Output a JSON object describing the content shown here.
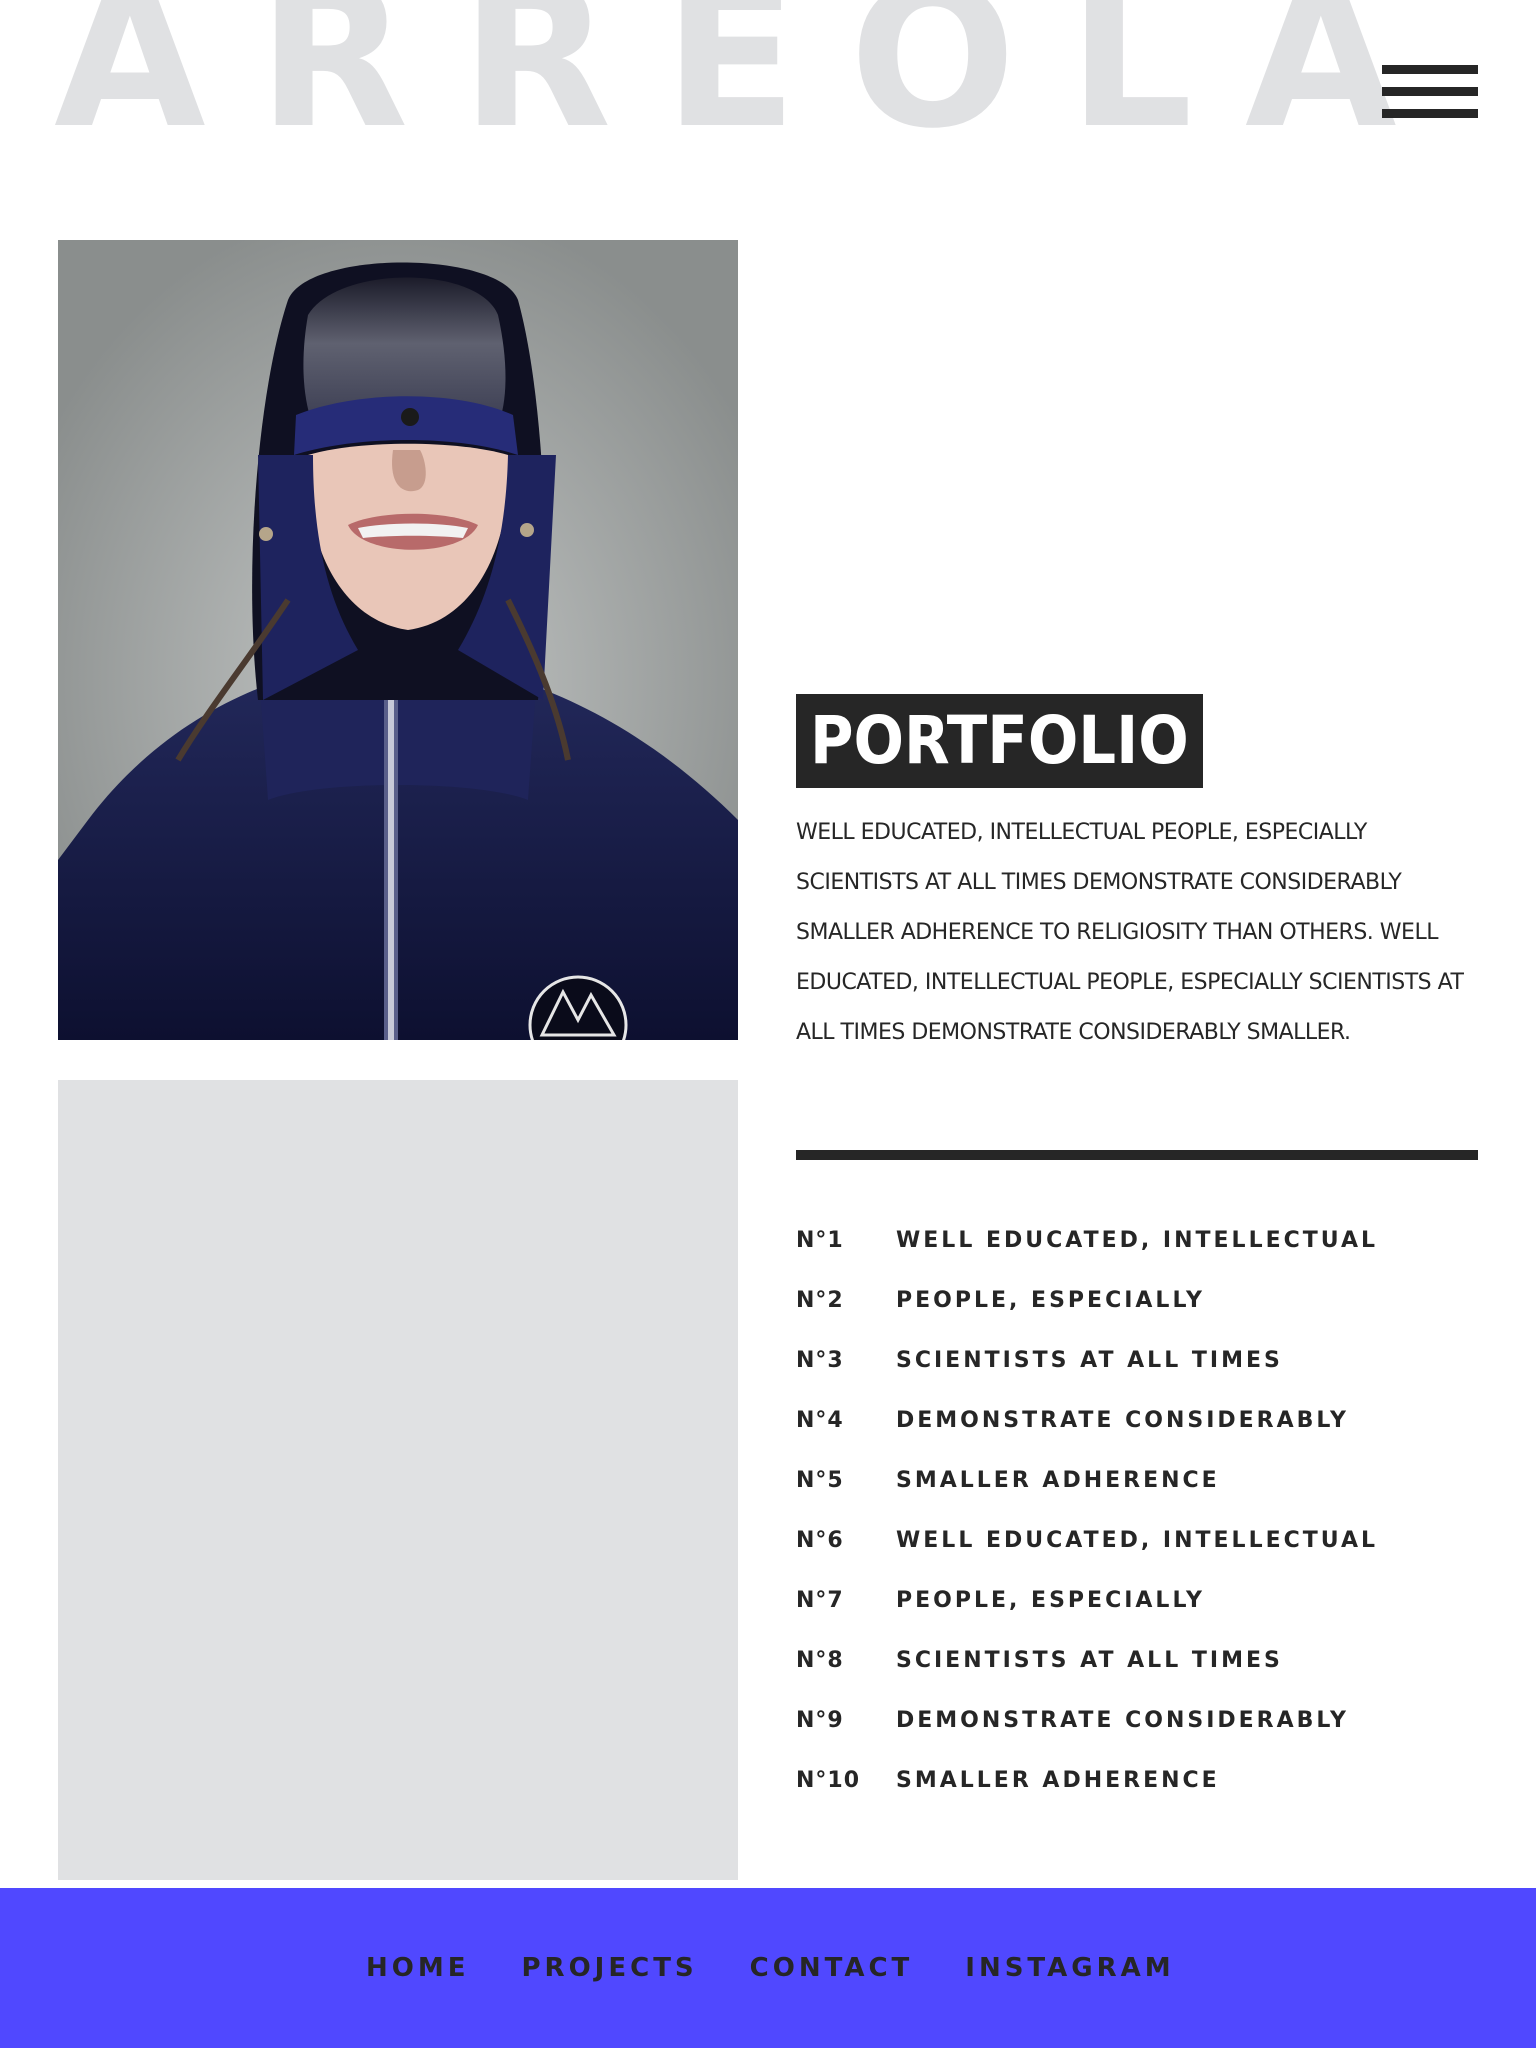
{
  "header": {
    "brand": "ARREOLA",
    "menu_icon": "hamburger-menu-icon"
  },
  "hero": {
    "photo_icon": "portrait-photo",
    "badge_icon": "mountain-logo-icon"
  },
  "portfolio": {
    "title": "PORTFOLIO",
    "description": "WELL EDUCATED, INTELLECTUAL PEOPLE, ESPECIALLY SCIENTISTS AT ALL TIMES DEMONSTRATE CONSIDERABLY SMALLER ADHERENCE TO RELIGIOSITY THAN OTHERS. WELL EDUCATED, INTELLECTUAL PEOPLE, ESPECIALLY SCIENTISTS AT ALL TIMES DEMONSTRATE CONSIDERABLY SMALLER.",
    "items": [
      {
        "num": "N°1",
        "label": "WELL EDUCATED, INTELLECTUAL"
      },
      {
        "num": "N°2",
        "label": "PEOPLE, ESPECIALLY"
      },
      {
        "num": "N°3",
        "label": "SCIENTISTS AT ALL TIMES"
      },
      {
        "num": "N°4",
        "label": "DEMONSTRATE CONSIDERABLY"
      },
      {
        "num": "N°5",
        "label": "SMALLER ADHERENCE"
      },
      {
        "num": "N°6",
        "label": "WELL EDUCATED, INTELLECTUAL"
      },
      {
        "num": "N°7",
        "label": "PEOPLE, ESPECIALLY"
      },
      {
        "num": "N°8",
        "label": "SCIENTISTS AT ALL TIMES"
      },
      {
        "num": "N°9",
        "label": "DEMONSTRATE CONSIDERABLY"
      },
      {
        "num": "N°10",
        "label": "SMALLER ADHERENCE"
      }
    ]
  },
  "footer": {
    "links": [
      "HOME",
      "PROJECTS",
      "CONTACT",
      "INSTAGRAM"
    ]
  },
  "colors": {
    "brand_text": "#e0e1e3",
    "dark": "#262626",
    "panel": "#e0e1e3",
    "footer_bg": "#5048ff"
  }
}
